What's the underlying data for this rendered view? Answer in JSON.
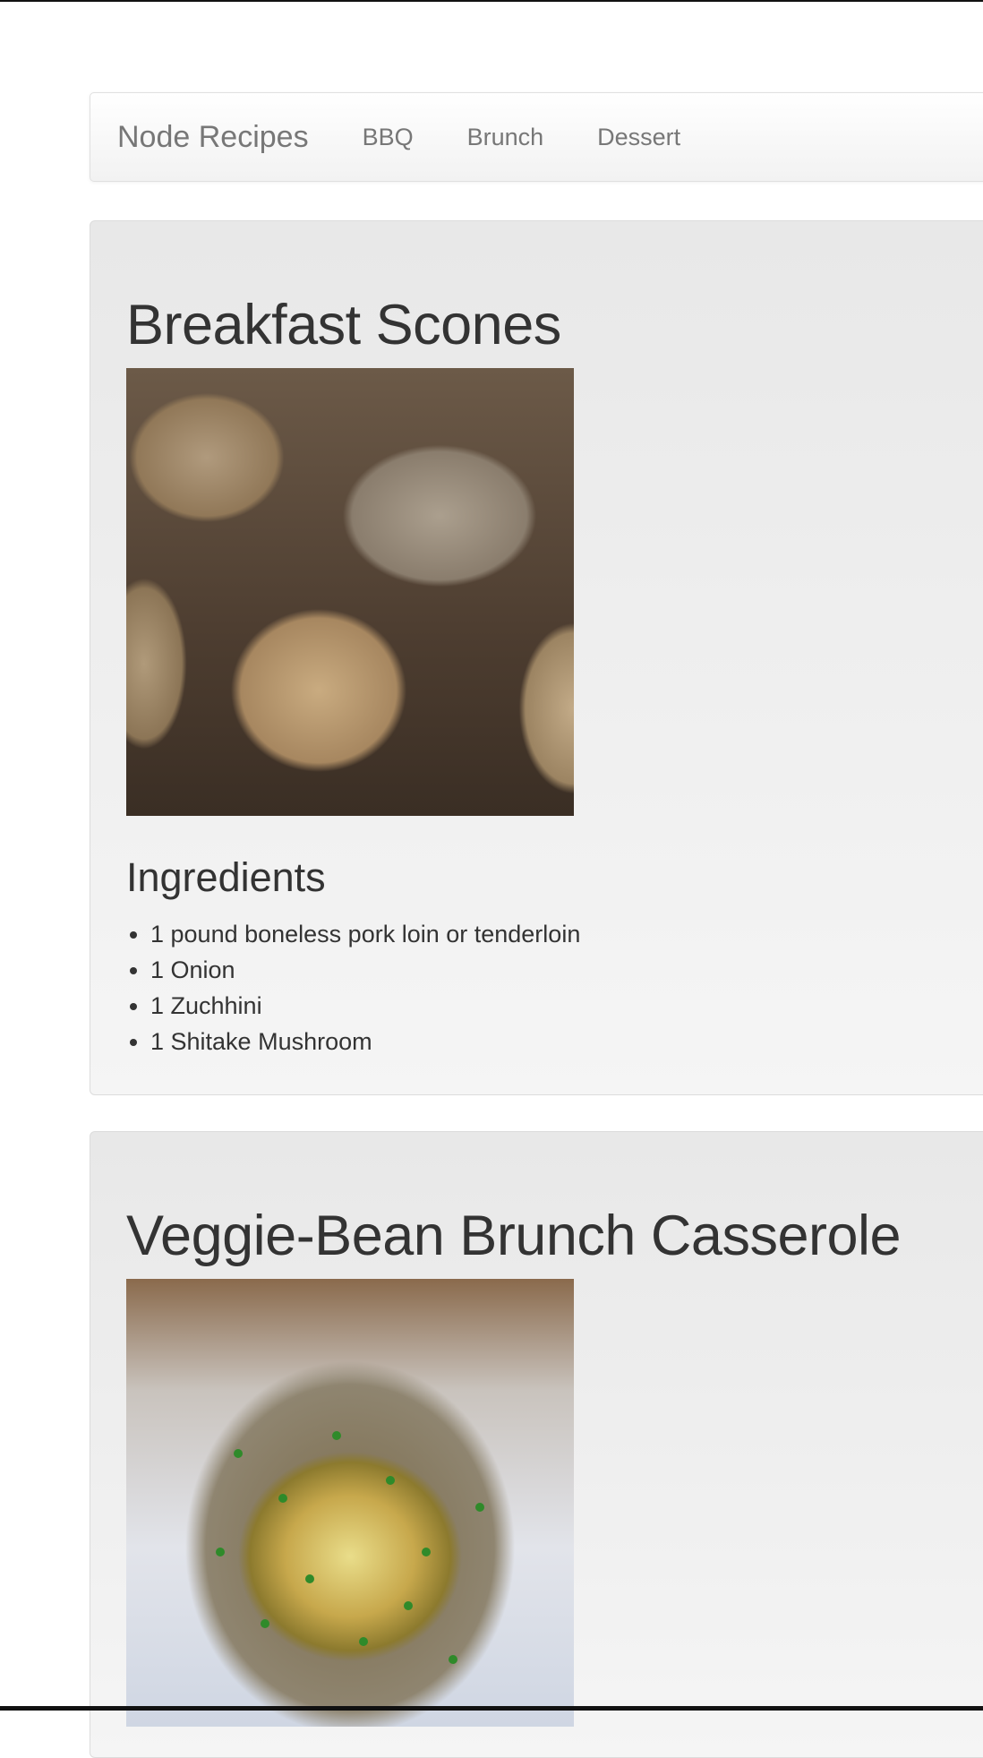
{
  "navbar": {
    "brand": "Node Recipes",
    "links": [
      "BBQ",
      "Brunch",
      "Dessert"
    ]
  },
  "recipes": [
    {
      "title": "Breakfast Scones",
      "image_alt": "Breakfast Scones photo",
      "ingredients_heading": "Ingredients",
      "ingredients": [
        "1 pound boneless pork loin or tenderloin",
        "1 Onion",
        "1 Zuchhini",
        "1 Shitake Mushroom"
      ]
    },
    {
      "title": "Veggie-Bean Brunch Casserole",
      "image_alt": "Veggie-Bean Brunch Casserole photo"
    }
  ]
}
